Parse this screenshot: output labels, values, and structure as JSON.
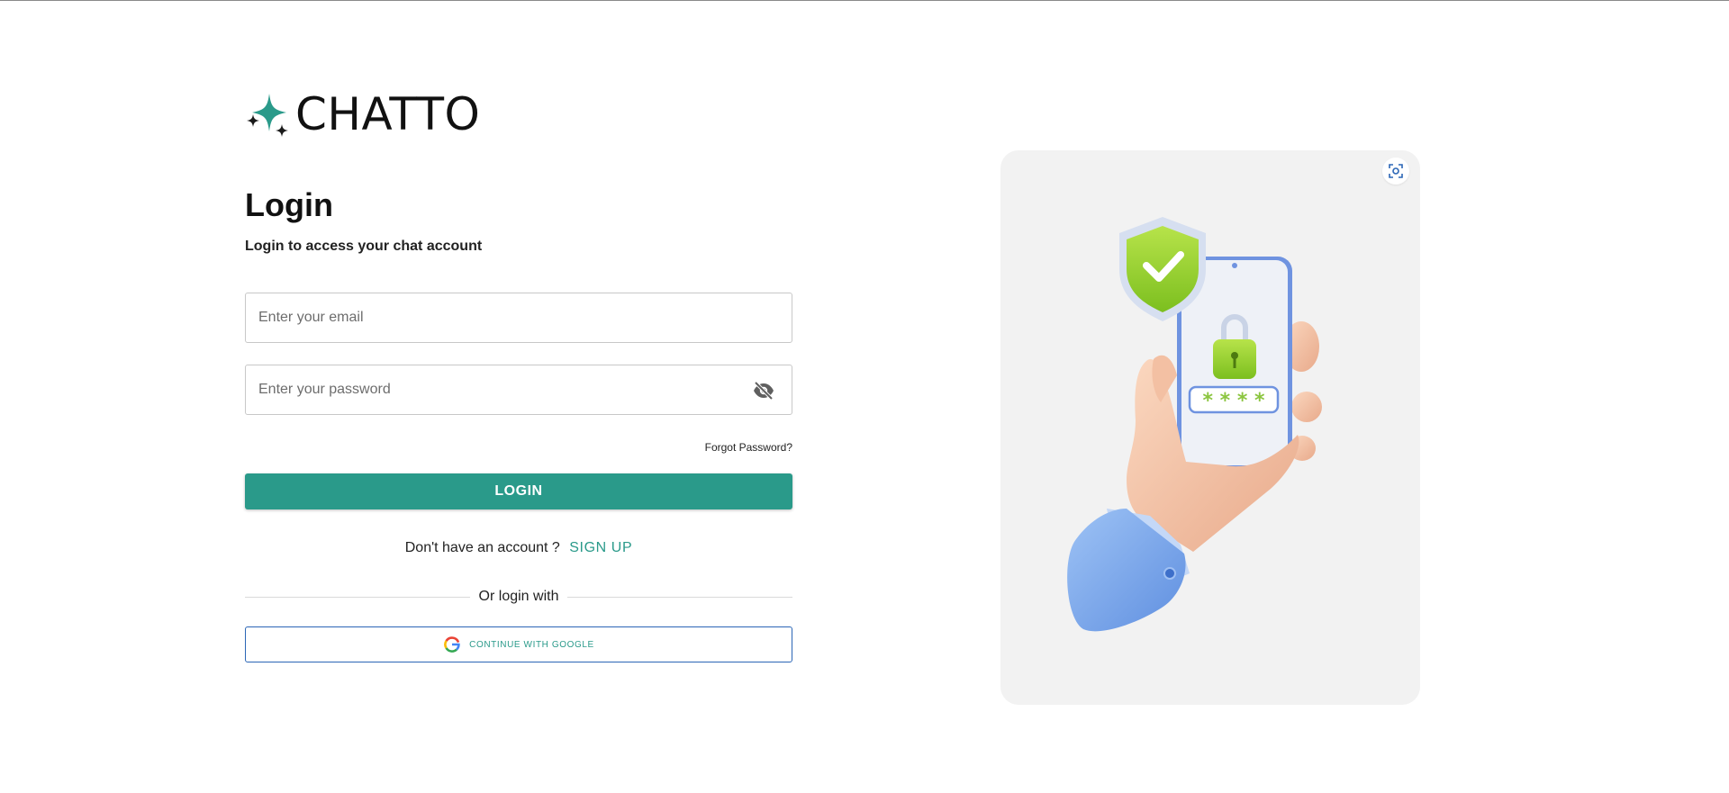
{
  "brand": {
    "name": "CHATTO"
  },
  "login": {
    "title": "Login",
    "subtitle": "Login to access your chat account",
    "email_placeholder": "Enter your email",
    "password_placeholder": "Enter your password",
    "forgot_password": "Forgot Password?",
    "login_button": "LOGIN",
    "no_account_text": "Don't have an account ?",
    "signup_link": "SIGN UP",
    "divider_text": "Or login with",
    "google_button": "CONTINUE WITH GOOGLE"
  },
  "icons": {
    "brand": "sparkle-icon",
    "password_toggle": "eye-off-icon",
    "google": "google-icon",
    "scan": "scan-focus-icon"
  },
  "colors": {
    "accent": "#2a9a8a",
    "google_border": "#2b66b6",
    "card_bg": "#f2f2f2"
  }
}
